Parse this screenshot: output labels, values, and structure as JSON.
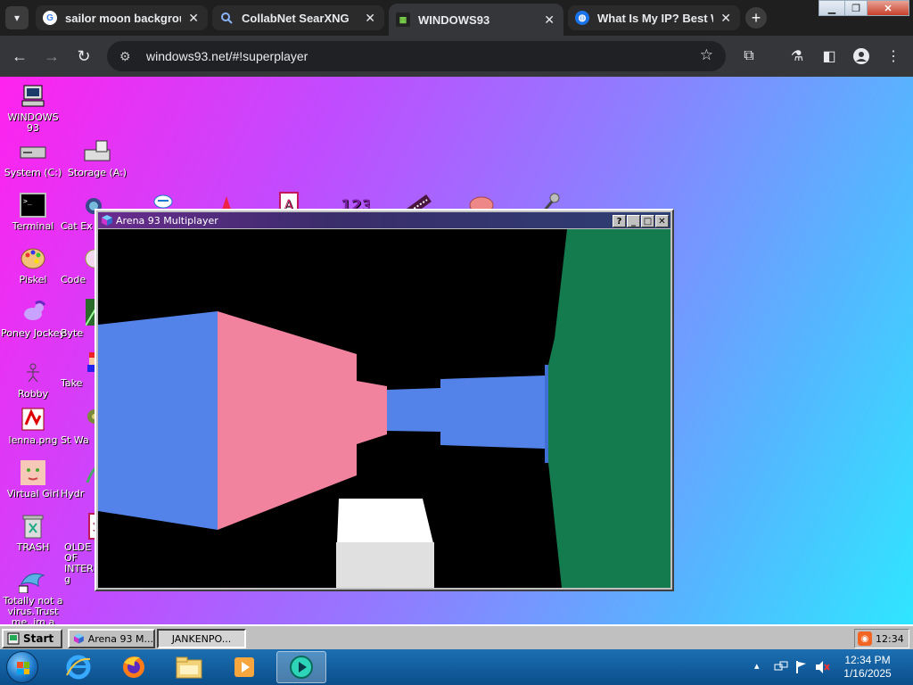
{
  "browser": {
    "tabs": [
      {
        "title": "sailor moon backgroun",
        "favicon": "google-icon",
        "active": false
      },
      {
        "title": "CollabNet SearXNG",
        "favicon": "search-icon",
        "active": false
      },
      {
        "title": "WINDOWS93",
        "favicon": "windows93-icon",
        "active": true
      },
      {
        "title": "What Is My IP? Best Wa",
        "favicon": "globe-icon",
        "active": false
      }
    ],
    "url": "windows93.net/#!superplayer",
    "tab_close_glyph": "✕",
    "new_tab_glyph": "+"
  },
  "desktop": {
    "background_colors": [
      "#ff22ee",
      "#8f7dff",
      "#2fe6ff"
    ],
    "icons_col1": [
      {
        "label": "WINDOWS 93",
        "icon": "computer-icon"
      },
      {
        "label": "System (C:)",
        "icon": "drive-icon"
      },
      {
        "label": "Terminal",
        "icon": "terminal-icon"
      },
      {
        "label": "Piskel",
        "icon": "palette-icon"
      },
      {
        "label": "Poney Jockey",
        "icon": "pony-icon"
      },
      {
        "label": "Robby",
        "icon": "robot-icon"
      },
      {
        "label": "lenna.png",
        "icon": "image-icon"
      },
      {
        "label": "Virtual Girl",
        "icon": "face-icon"
      },
      {
        "label": "TRASH",
        "icon": "trash-icon"
      },
      {
        "label": "Totally not a virus.Trust me..im a",
        "icon": "dolphin-icon"
      }
    ],
    "icons_col2": [
      {
        "label": "Storage (A:)",
        "icon": "floppy-drive-icon"
      },
      {
        "label": "Cat Ex",
        "icon": "cat-icon"
      },
      {
        "label": "Code",
        "icon": "code-icon"
      },
      {
        "label": "Byte",
        "icon": "bytebeat-icon"
      },
      {
        "label": "Take",
        "icon": "mario-icon"
      },
      {
        "label": "St Wa",
        "icon": "alien-icon"
      },
      {
        "label": "Hydr",
        "icon": "hydra-icon"
      },
      {
        "label": "OLDE OF INTER g",
        "icon": "book-icon"
      }
    ]
  },
  "game_window": {
    "title": "Arena 93 Multiplayer",
    "buttons": {
      "help": "?",
      "minimize": "_",
      "maximize": "□",
      "close": "✕"
    }
  },
  "w93_taskbar": {
    "start_label": "Start",
    "items": [
      {
        "label": "Arena 93 M...",
        "pressed": false
      },
      {
        "label": "JANKENPO...",
        "pressed": true
      }
    ],
    "clock": "12:34"
  },
  "win7_taskbar": {
    "time": "12:34 PM",
    "date": "1/16/2025",
    "pinned": [
      "internet-explorer-icon",
      "firefox-icon",
      "file-explorer-icon",
      "media-player-icon",
      "media-center-icon"
    ]
  }
}
